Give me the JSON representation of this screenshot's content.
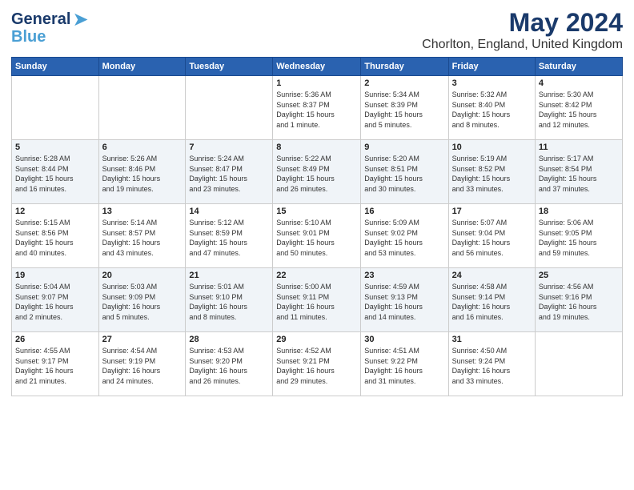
{
  "header": {
    "logo_general": "General",
    "logo_blue": "Blue",
    "month_year": "May 2024",
    "location": "Chorlton, England, United Kingdom"
  },
  "days_of_week": [
    "Sunday",
    "Monday",
    "Tuesday",
    "Wednesday",
    "Thursday",
    "Friday",
    "Saturday"
  ],
  "weeks": [
    [
      {
        "day": "",
        "info": ""
      },
      {
        "day": "",
        "info": ""
      },
      {
        "day": "",
        "info": ""
      },
      {
        "day": "1",
        "info": "Sunrise: 5:36 AM\nSunset: 8:37 PM\nDaylight: 15 hours\nand 1 minute."
      },
      {
        "day": "2",
        "info": "Sunrise: 5:34 AM\nSunset: 8:39 PM\nDaylight: 15 hours\nand 5 minutes."
      },
      {
        "day": "3",
        "info": "Sunrise: 5:32 AM\nSunset: 8:40 PM\nDaylight: 15 hours\nand 8 minutes."
      },
      {
        "day": "4",
        "info": "Sunrise: 5:30 AM\nSunset: 8:42 PM\nDaylight: 15 hours\nand 12 minutes."
      }
    ],
    [
      {
        "day": "5",
        "info": "Sunrise: 5:28 AM\nSunset: 8:44 PM\nDaylight: 15 hours\nand 16 minutes."
      },
      {
        "day": "6",
        "info": "Sunrise: 5:26 AM\nSunset: 8:46 PM\nDaylight: 15 hours\nand 19 minutes."
      },
      {
        "day": "7",
        "info": "Sunrise: 5:24 AM\nSunset: 8:47 PM\nDaylight: 15 hours\nand 23 minutes."
      },
      {
        "day": "8",
        "info": "Sunrise: 5:22 AM\nSunset: 8:49 PM\nDaylight: 15 hours\nand 26 minutes."
      },
      {
        "day": "9",
        "info": "Sunrise: 5:20 AM\nSunset: 8:51 PM\nDaylight: 15 hours\nand 30 minutes."
      },
      {
        "day": "10",
        "info": "Sunrise: 5:19 AM\nSunset: 8:52 PM\nDaylight: 15 hours\nand 33 minutes."
      },
      {
        "day": "11",
        "info": "Sunrise: 5:17 AM\nSunset: 8:54 PM\nDaylight: 15 hours\nand 37 minutes."
      }
    ],
    [
      {
        "day": "12",
        "info": "Sunrise: 5:15 AM\nSunset: 8:56 PM\nDaylight: 15 hours\nand 40 minutes."
      },
      {
        "day": "13",
        "info": "Sunrise: 5:14 AM\nSunset: 8:57 PM\nDaylight: 15 hours\nand 43 minutes."
      },
      {
        "day": "14",
        "info": "Sunrise: 5:12 AM\nSunset: 8:59 PM\nDaylight: 15 hours\nand 47 minutes."
      },
      {
        "day": "15",
        "info": "Sunrise: 5:10 AM\nSunset: 9:01 PM\nDaylight: 15 hours\nand 50 minutes."
      },
      {
        "day": "16",
        "info": "Sunrise: 5:09 AM\nSunset: 9:02 PM\nDaylight: 15 hours\nand 53 minutes."
      },
      {
        "day": "17",
        "info": "Sunrise: 5:07 AM\nSunset: 9:04 PM\nDaylight: 15 hours\nand 56 minutes."
      },
      {
        "day": "18",
        "info": "Sunrise: 5:06 AM\nSunset: 9:05 PM\nDaylight: 15 hours\nand 59 minutes."
      }
    ],
    [
      {
        "day": "19",
        "info": "Sunrise: 5:04 AM\nSunset: 9:07 PM\nDaylight: 16 hours\nand 2 minutes."
      },
      {
        "day": "20",
        "info": "Sunrise: 5:03 AM\nSunset: 9:09 PM\nDaylight: 16 hours\nand 5 minutes."
      },
      {
        "day": "21",
        "info": "Sunrise: 5:01 AM\nSunset: 9:10 PM\nDaylight: 16 hours\nand 8 minutes."
      },
      {
        "day": "22",
        "info": "Sunrise: 5:00 AM\nSunset: 9:11 PM\nDaylight: 16 hours\nand 11 minutes."
      },
      {
        "day": "23",
        "info": "Sunrise: 4:59 AM\nSunset: 9:13 PM\nDaylight: 16 hours\nand 14 minutes."
      },
      {
        "day": "24",
        "info": "Sunrise: 4:58 AM\nSunset: 9:14 PM\nDaylight: 16 hours\nand 16 minutes."
      },
      {
        "day": "25",
        "info": "Sunrise: 4:56 AM\nSunset: 9:16 PM\nDaylight: 16 hours\nand 19 minutes."
      }
    ],
    [
      {
        "day": "26",
        "info": "Sunrise: 4:55 AM\nSunset: 9:17 PM\nDaylight: 16 hours\nand 21 minutes."
      },
      {
        "day": "27",
        "info": "Sunrise: 4:54 AM\nSunset: 9:19 PM\nDaylight: 16 hours\nand 24 minutes."
      },
      {
        "day": "28",
        "info": "Sunrise: 4:53 AM\nSunset: 9:20 PM\nDaylight: 16 hours\nand 26 minutes."
      },
      {
        "day": "29",
        "info": "Sunrise: 4:52 AM\nSunset: 9:21 PM\nDaylight: 16 hours\nand 29 minutes."
      },
      {
        "day": "30",
        "info": "Sunrise: 4:51 AM\nSunset: 9:22 PM\nDaylight: 16 hours\nand 31 minutes."
      },
      {
        "day": "31",
        "info": "Sunrise: 4:50 AM\nSunset: 9:24 PM\nDaylight: 16 hours\nand 33 minutes."
      },
      {
        "day": "",
        "info": ""
      }
    ]
  ]
}
